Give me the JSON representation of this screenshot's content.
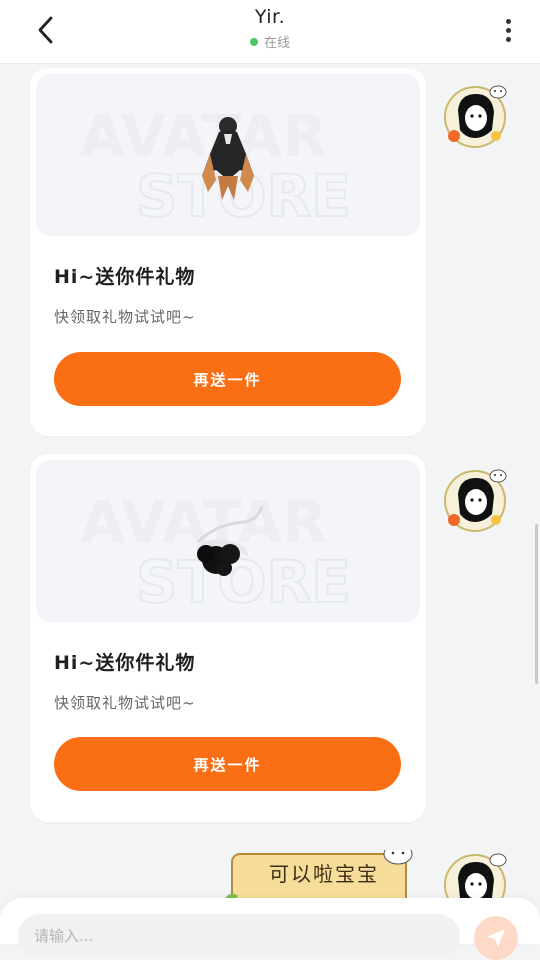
{
  "header": {
    "contact_name": "Yir.",
    "status_text": "在线",
    "status_color": "#4cc766",
    "back_icon": "chevron-left-icon",
    "more_icon": "more-vertical-icon"
  },
  "messages": [
    {
      "type": "gift",
      "sender": "other",
      "title": "Hi~送你件礼物",
      "subtitle": "快领取礼物试试吧~",
      "button_label": "再送一件",
      "item": "dark-cape-outfit",
      "watermark": [
        "AVATAR",
        "STORE"
      ]
    },
    {
      "type": "gift",
      "sender": "other",
      "title": "Hi~送你件礼物",
      "subtitle": "快领取礼物试试吧~",
      "button_label": "再送一件",
      "item": "black-bow-headband",
      "watermark": [
        "AVATAR",
        "STORE"
      ]
    },
    {
      "type": "sticker",
      "sender": "other",
      "text": "可以啦宝宝"
    }
  ],
  "input": {
    "placeholder": "请输入...",
    "value": ""
  },
  "colors": {
    "accent": "#fa6e14",
    "send_button": "#ffd9c7",
    "background": "#f3f4f6"
  }
}
